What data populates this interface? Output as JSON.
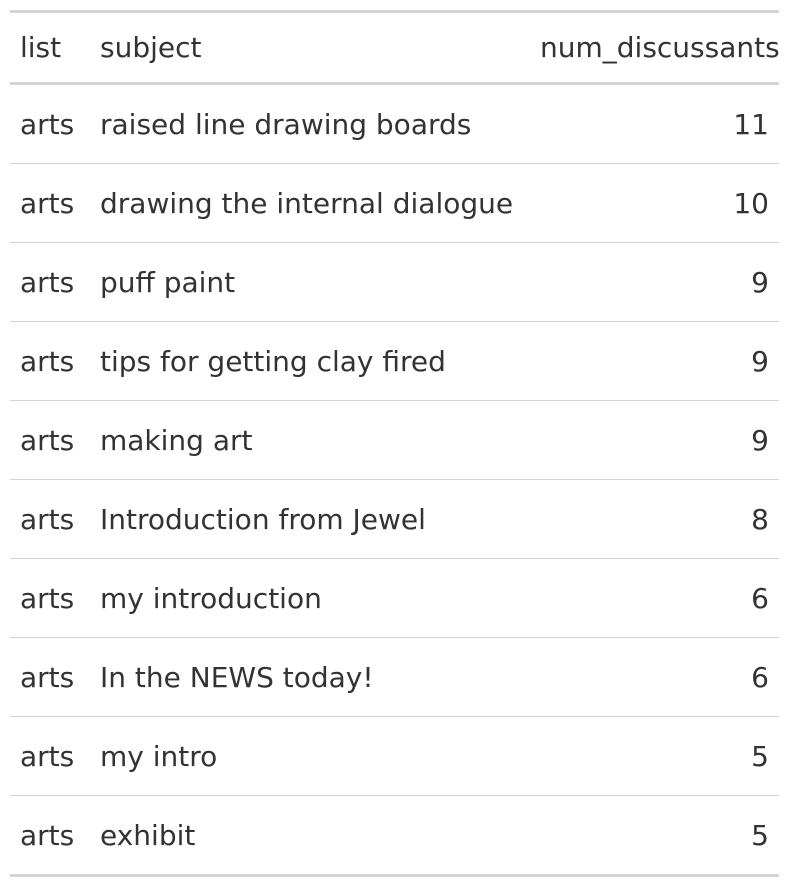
{
  "table": {
    "columns": [
      "list",
      "subject",
      "num_discussants"
    ],
    "rows": [
      {
        "list": "arts",
        "subject": "raised line drawing boards",
        "num_discussants": "11"
      },
      {
        "list": "arts",
        "subject": "drawing the internal dialogue",
        "num_discussants": "10"
      },
      {
        "list": "arts",
        "subject": "puff paint",
        "num_discussants": "9"
      },
      {
        "list": "arts",
        "subject": "tips for getting clay fired",
        "num_discussants": "9"
      },
      {
        "list": "arts",
        "subject": "making art",
        "num_discussants": "9"
      },
      {
        "list": "arts",
        "subject": "Introduction from Jewel",
        "num_discussants": "8"
      },
      {
        "list": "arts",
        "subject": "my introduction",
        "num_discussants": "6"
      },
      {
        "list": "arts",
        "subject": "In the NEWS today!",
        "num_discussants": "6"
      },
      {
        "list": "arts",
        "subject": "my intro",
        "num_discussants": "5"
      },
      {
        "list": "arts",
        "subject": "exhibit",
        "num_discussants": "5"
      }
    ]
  },
  "colors": {
    "text": "#333333",
    "rule": "#d3d3d3",
    "background": "#ffffff"
  }
}
